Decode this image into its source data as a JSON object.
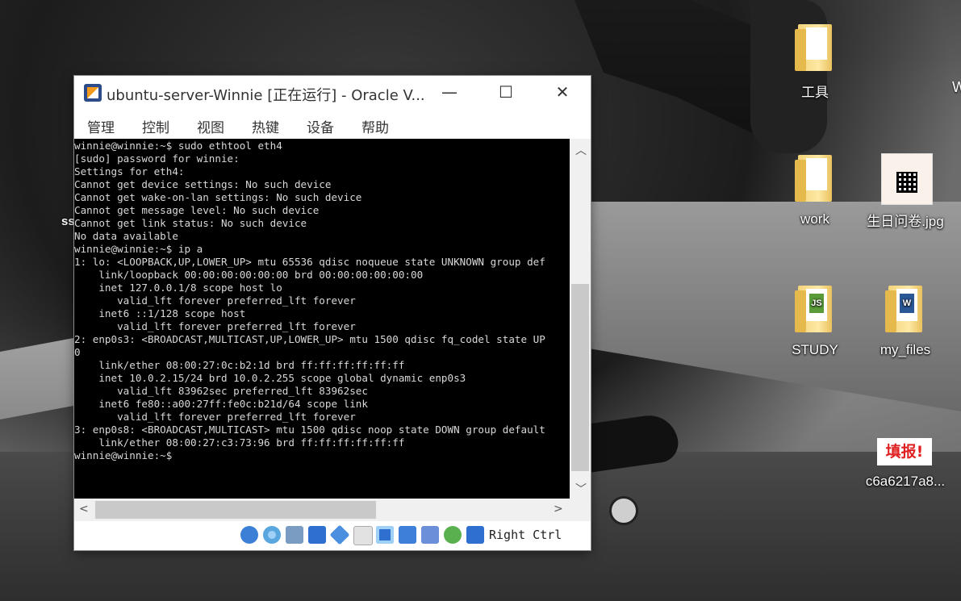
{
  "desktop": {
    "icons": [
      {
        "label": "工具"
      },
      {
        "label": "work"
      },
      {
        "label": "生日问卷.jpg"
      },
      {
        "label": "STUDY"
      },
      {
        "label": "my_files"
      },
      {
        "label": "c6a6217a8..."
      }
    ],
    "tianbao_text": "填报!",
    "stray_text": "ss",
    "edge_text": "W"
  },
  "window": {
    "title": "ubuntu-server-Winnie [正在运行] - Oracle V...",
    "minimize": "—",
    "maximize": "☐",
    "close": "✕",
    "menu": [
      "管理",
      "控制",
      "视图",
      "热键",
      "设备",
      "帮助"
    ]
  },
  "terminal": {
    "lines": [
      "winnie@winnie:~$ sudo ethtool eth4",
      "[sudo] password for winnie:",
      "Settings for eth4:",
      "Cannot get device settings: No such device",
      "Cannot get wake-on-lan settings: No such device",
      "Cannot get message level: No such device",
      "Cannot get link status: No such device",
      "No data available",
      "winnie@winnie:~$ ip a",
      "1: lo: <LOOPBACK,UP,LOWER_UP> mtu 65536 qdisc noqueue state UNKNOWN group def",
      "    link/loopback 00:00:00:00:00:00 brd 00:00:00:00:00:00",
      "    inet 127.0.0.1/8 scope host lo",
      "       valid_lft forever preferred_lft forever",
      "    inet6 ::1/128 scope host",
      "       valid_lft forever preferred_lft forever",
      "2: enp0s3: <BROADCAST,MULTICAST,UP,LOWER_UP> mtu 1500 qdisc fq_codel state UP",
      "0",
      "    link/ether 08:00:27:0c:b2:1d brd ff:ff:ff:ff:ff:ff",
      "    inet 10.0.2.15/24 brd 10.0.2.255 scope global dynamic enp0s3",
      "       valid_lft 83962sec preferred_lft 83962sec",
      "    inet6 fe80::a00:27ff:fe0c:b21d/64 scope link",
      "       valid_lft forever preferred_lft forever",
      "3: enp0s8: <BROADCAST,MULTICAST> mtu 1500 qdisc noop state DOWN group default",
      "    link/ether 08:00:27:c3:73:96 brd ff:ff:ff:ff:ff:ff",
      "winnie@winnie:~$"
    ]
  },
  "statusbar": {
    "host_key": "Right Ctrl",
    "icons": [
      "hard-disk-icon",
      "optical-drive-icon",
      "audio-icon",
      "network-icon",
      "usb-icon",
      "shared-folders-icon",
      "display-icon",
      "recording-icon",
      "vrde-icon",
      "mouse-integration-icon",
      "keyboard-capture-icon"
    ]
  },
  "colors": {
    "terminal_bg": "#000000",
    "terminal_fg": "#d8d8d8",
    "tianbao_red": "#e02020"
  }
}
